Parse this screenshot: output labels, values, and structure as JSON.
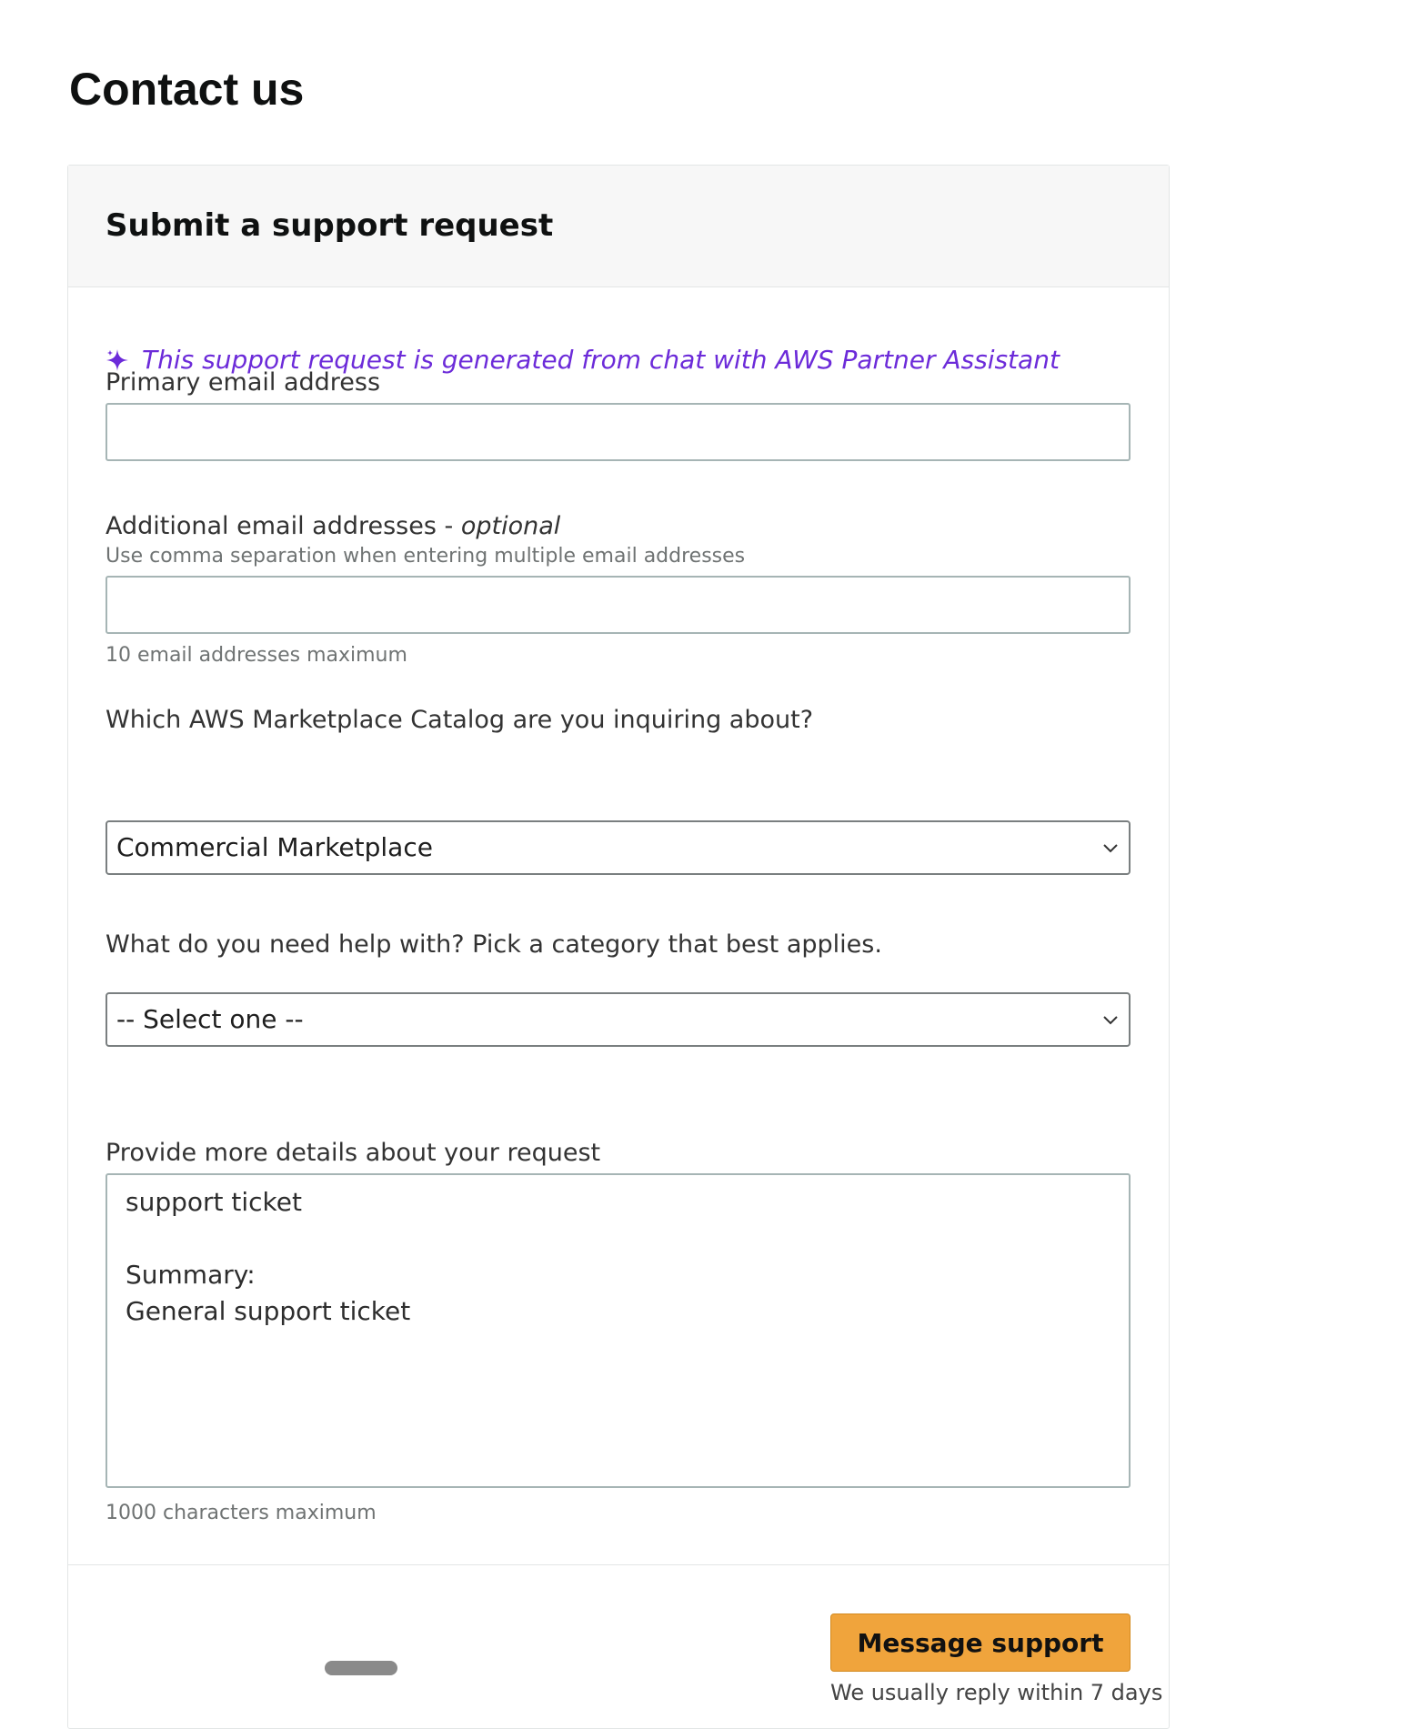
{
  "page": {
    "title": "Contact us"
  },
  "form": {
    "header": "Submit a support request",
    "assistant_note": "This support request is generated from chat with AWS Partner Assistant",
    "assistant_icon": "sparkle-icon",
    "accent_color": "#6c2bd9",
    "primary_email": {
      "label": "Primary email address",
      "value": "",
      "placeholder": ""
    },
    "additional_emails": {
      "label": "Additional email addresses - ",
      "label_optional": "optional",
      "hint": "Use comma separation when entering multiple email addresses",
      "value": "",
      "placeholder": "",
      "constraint": "10 email addresses maximum"
    },
    "catalog": {
      "label": "Which AWS Marketplace Catalog are you inquiring about?",
      "selected": "Commercial Marketplace"
    },
    "category": {
      "label": "What do you need help with? Pick a category that best applies.",
      "selected": "-- Select one --"
    },
    "details": {
      "label": "Provide more details about your request",
      "lines": [
        "support ticket",
        "",
        "Summary:",
        "General support ticket"
      ],
      "constraint": "1000 characters maximum"
    },
    "submit": {
      "label": "Message support",
      "color": "#f0a43c",
      "reply_note": "We usually reply within 7 days"
    }
  }
}
